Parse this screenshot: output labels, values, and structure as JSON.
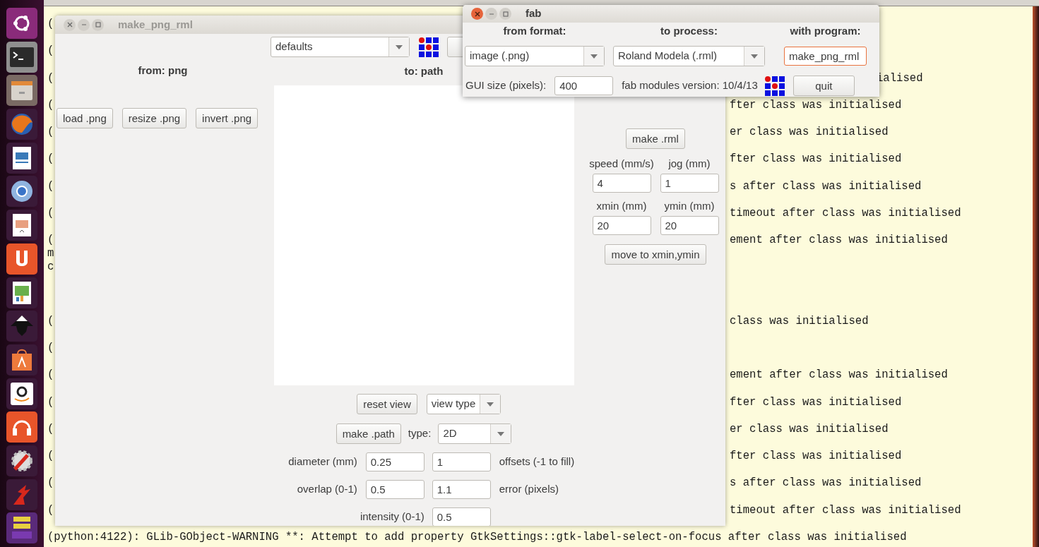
{
  "terminal": {
    "lines": [
      {
        "kind": "left_only",
        "left": "("
      },
      {
        "kind": "blank"
      },
      {
        "kind": "left_only",
        "left": "("
      },
      {
        "kind": "blank"
      },
      {
        "kind": "beside_fab",
        "left": "(",
        "right": "ialised"
      },
      {
        "kind": "blank"
      },
      {
        "kind": "beside_main",
        "left": "(",
        "right": "fter class was initialised"
      },
      {
        "kind": "blank"
      },
      {
        "kind": "beside_main",
        "left": "(",
        "right": "er class was initialised"
      },
      {
        "kind": "blank"
      },
      {
        "kind": "beside_main",
        "left": "(",
        "right": "fter class was initialised"
      },
      {
        "kind": "blank"
      },
      {
        "kind": "beside_main",
        "left": "(",
        "right": "s after class was initialised"
      },
      {
        "kind": "blank"
      },
      {
        "kind": "beside_main",
        "left": "(",
        "right": "timeout after class was initialised"
      },
      {
        "kind": "blank"
      },
      {
        "kind": "beside_main",
        "left": "(",
        "right": "ement after class was initialised"
      },
      {
        "kind": "left_only",
        "left": "m"
      },
      {
        "kind": "left_only",
        "left": "c"
      },
      {
        "kind": "blank"
      },
      {
        "kind": "blank"
      },
      {
        "kind": "blank"
      },
      {
        "kind": "beside_main",
        "left": "(",
        "right": "class was initialised"
      },
      {
        "kind": "blank"
      },
      {
        "kind": "left_only",
        "left": "("
      },
      {
        "kind": "blank"
      },
      {
        "kind": "beside_main",
        "left": "(",
        "right": "ement after class was initialised"
      },
      {
        "kind": "blank"
      },
      {
        "kind": "beside_main",
        "left": "(",
        "right": "fter class was initialised"
      },
      {
        "kind": "blank"
      },
      {
        "kind": "beside_main",
        "left": "(",
        "right": "er class was initialised"
      },
      {
        "kind": "blank"
      },
      {
        "kind": "beside_main",
        "left": "(",
        "right": "fter class was initialised"
      },
      {
        "kind": "blank"
      },
      {
        "kind": "beside_main",
        "left": "(",
        "right": "s after class was initialised"
      },
      {
        "kind": "blank"
      },
      {
        "kind": "beside_main",
        "left": "(",
        "right": "timeout after class was initialised"
      },
      {
        "kind": "blank"
      },
      {
        "kind": "full",
        "left": "(python:4122): GLib-GObject-WARNING **: Attempt to add property GtkSettings::gtk-label-select-on-focus after class was initialised"
      }
    ]
  },
  "main_window": {
    "title": "make_png_rml",
    "active": false,
    "preset": "defaults",
    "from_heading": "from: png",
    "to_heading": "to: path",
    "png_buttons": [
      "load .png",
      "resize .png",
      "invert .png"
    ],
    "view": {
      "reset_button": "reset view",
      "view_type": "view type"
    },
    "path": {
      "make_button": "make .path",
      "type_label": "type:",
      "type_value": "2D",
      "rows": [
        {
          "left": [
            {
              "kind": "label",
              "text": "diameter (mm)"
            },
            {
              "kind": "field",
              "value": "0.25"
            }
          ],
          "right": [
            {
              "kind": "field",
              "value": "1"
            },
            {
              "kind": "label",
              "text": "offsets (-1 to fill)"
            }
          ]
        },
        {
          "left": [
            {
              "kind": "label",
              "text": "overlap (0-1)"
            },
            {
              "kind": "field",
              "value": "0.5"
            }
          ],
          "right": [
            {
              "kind": "field",
              "value": "1.1"
            },
            {
              "kind": "label",
              "text": "error (pixels)"
            }
          ]
        },
        {
          "left": [
            {
              "kind": "label",
              "text": "intensity (0-1)"
            }
          ],
          "right": [
            {
              "kind": "field",
              "value": "0.5"
            }
          ]
        }
      ]
    },
    "rml": {
      "make_button": "make .rml",
      "fields": [
        {
          "label": "speed (mm/s)",
          "value": "4"
        },
        {
          "label": "jog (mm)",
          "value": "1"
        },
        {
          "label": "xmin (mm)",
          "value": "20"
        },
        {
          "label": "ymin (mm)",
          "value": "20"
        }
      ],
      "move_button": "move to xmin,ymin"
    }
  },
  "fab_window": {
    "title": "fab",
    "active": true,
    "headings": [
      "from format:",
      "to process:",
      "with program:"
    ],
    "from_format": "image (.png)",
    "process": "Roland Modela (.rml)",
    "program": {
      "value": "make_png_rml",
      "focused": true
    },
    "gui_size_label": "GUI size (pixels):",
    "gui_size": "400",
    "version": "fab modules version: 10/4/13",
    "quit_button": "quit"
  }
}
